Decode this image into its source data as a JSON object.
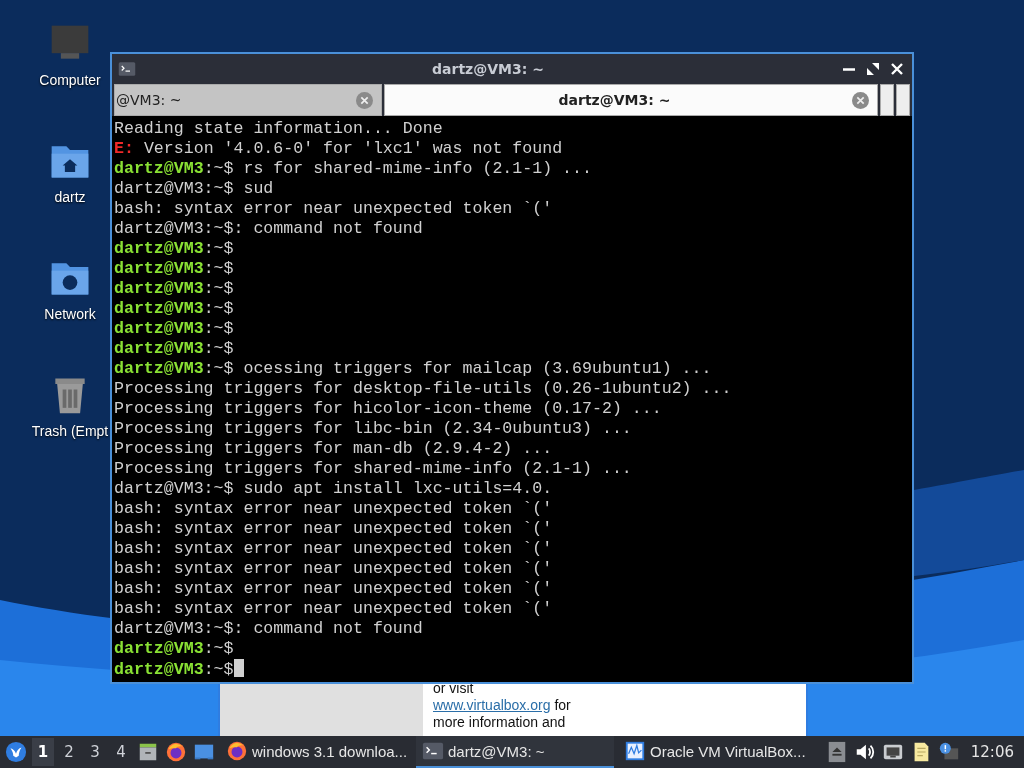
{
  "desktop_icons": [
    {
      "kind": "computer",
      "label": "Computer"
    },
    {
      "kind": "home",
      "label": "dartz"
    },
    {
      "kind": "network",
      "label": "Network"
    },
    {
      "kind": "trash",
      "label": "Trash (Empt"
    }
  ],
  "background_window": {
    "paragraph": [
      "or visit",
      "www.virtualbox.org",
      " for",
      "more information and"
    ]
  },
  "terminal": {
    "title": "dartz@VM3: ~",
    "tabs": [
      {
        "label": "@VM3: ~",
        "selected": false
      },
      {
        "label": "dartz@VM3: ~",
        "selected": true
      }
    ],
    "lines": [
      {
        "kind": "plain",
        "text": "Reading state information... Done"
      },
      {
        "kind": "error",
        "tag": "E:",
        "text": " Version '4.0.6-0' for 'lxc1' was not found"
      },
      {
        "kind": "prompt",
        "user": "dartz@VM3",
        "path": ":~$",
        "text": " rs for shared-mime-info (2.1-1) ..."
      },
      {
        "kind": "plain",
        "text": "dartz@VM3:~$ sud"
      },
      {
        "kind": "plain",
        "text": "bash: syntax error near unexpected token `('"
      },
      {
        "kind": "plain",
        "text": "dartz@VM3:~$: command not found"
      },
      {
        "kind": "prompt",
        "user": "dartz@VM3",
        "path": ":~$"
      },
      {
        "kind": "prompt",
        "user": "dartz@VM3",
        "path": ":~$"
      },
      {
        "kind": "prompt",
        "user": "dartz@VM3",
        "path": ":~$"
      },
      {
        "kind": "prompt",
        "user": "dartz@VM3",
        "path": ":~$"
      },
      {
        "kind": "prompt",
        "user": "dartz@VM3",
        "path": ":~$"
      },
      {
        "kind": "prompt",
        "user": "dartz@VM3",
        "path": ":~$"
      },
      {
        "kind": "prompt",
        "user": "dartz@VM3",
        "path": ":~$",
        "text": " ocessing triggers for mailcap (3.69ubuntu1) ..."
      },
      {
        "kind": "plain",
        "text": "Processing triggers for desktop-file-utils (0.26-1ubuntu2) ..."
      },
      {
        "kind": "plain",
        "text": "Processing triggers for hicolor-icon-theme (0.17-2) ..."
      },
      {
        "kind": "plain",
        "text": "Processing triggers for libc-bin (2.34-0ubuntu3) ..."
      },
      {
        "kind": "plain",
        "text": "Processing triggers for man-db (2.9.4-2) ..."
      },
      {
        "kind": "plain",
        "text": "Processing triggers for shared-mime-info (2.1-1) ..."
      },
      {
        "kind": "plain",
        "text": "dartz@VM3:~$ sudo apt install lxc-utils=4.0."
      },
      {
        "kind": "plain",
        "text": "bash: syntax error near unexpected token `('"
      },
      {
        "kind": "plain",
        "text": "bash: syntax error near unexpected token `('"
      },
      {
        "kind": "plain",
        "text": "bash: syntax error near unexpected token `('"
      },
      {
        "kind": "plain",
        "text": "bash: syntax error near unexpected token `('"
      },
      {
        "kind": "plain",
        "text": "bash: syntax error near unexpected token `('"
      },
      {
        "kind": "plain",
        "text": "bash: syntax error near unexpected token `('"
      },
      {
        "kind": "plain",
        "text": "dartz@VM3:~$: command not found"
      },
      {
        "kind": "prompt",
        "user": "dartz@VM3",
        "path": ":~$"
      },
      {
        "kind": "prompt",
        "user": "dartz@VM3",
        "path": ":~$",
        "cursor": true
      }
    ]
  },
  "taskbar": {
    "workspaces": [
      {
        "label": "1",
        "selected": true
      },
      {
        "label": "2",
        "selected": false
      },
      {
        "label": "3",
        "selected": false
      },
      {
        "label": "4",
        "selected": false
      }
    ],
    "launchers": [
      {
        "kind": "files"
      },
      {
        "kind": "firefox"
      },
      {
        "kind": "desktop"
      }
    ],
    "tasks": [
      {
        "kind": "firefox",
        "label": "windows 3.1 downloa...",
        "selected": false
      },
      {
        "kind": "terminal",
        "label": "dartz@VM3: ~",
        "selected": true
      },
      {
        "kind": "virtualbox",
        "label": "Oracle VM VirtualBox...",
        "selected": false
      }
    ],
    "tray": [
      {
        "kind": "eject"
      },
      {
        "kind": "volume"
      },
      {
        "kind": "network"
      },
      {
        "kind": "clipboard"
      },
      {
        "kind": "notification"
      }
    ],
    "clock": "12:06"
  }
}
